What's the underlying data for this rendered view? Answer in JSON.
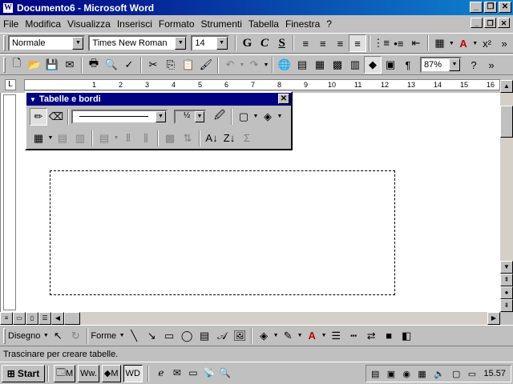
{
  "window": {
    "title": "Documento6 - Microsoft Word",
    "app_icon": "W"
  },
  "menus": [
    "File",
    "Modifica",
    "Visualizza",
    "Inserisci",
    "Formato",
    "Strumenti",
    "Tabella",
    "Finestra",
    "?"
  ],
  "format_bar": {
    "style": "Normale",
    "font": "Times New Roman",
    "size": "14",
    "bold": "G",
    "italic": "C",
    "underline": "S"
  },
  "standard_bar": {
    "zoom": "87%"
  },
  "ruler": {
    "numbers": [
      "1",
      "2",
      "3",
      "4",
      "5",
      "6",
      "7",
      "8",
      "9",
      "10",
      "11",
      "12",
      "13",
      "14",
      "15",
      "16"
    ]
  },
  "tables_toolbar": {
    "title": "Tabelle e bordi",
    "line_weight": "½",
    "close": "✕"
  },
  "drawing_bar": {
    "draw_label": "Disegno",
    "shapes_label": "Forme"
  },
  "status": {
    "text": "Trascinare per creare tabelle."
  },
  "taskbar": {
    "start": "Start",
    "tasks": [
      "M",
      "w.",
      "M",
      "D"
    ],
    "clock": "15.57"
  },
  "colors": {
    "title_start": "#000080",
    "title_end": "#1084d0",
    "face": "#c0c0c0"
  }
}
